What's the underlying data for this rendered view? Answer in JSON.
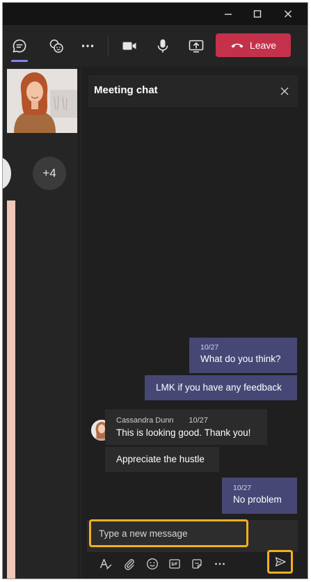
{
  "window": {
    "controls": [
      {
        "name": "minimize-button",
        "icon": "minimize-icon"
      },
      {
        "name": "maximize-button",
        "icon": "maximize-icon"
      },
      {
        "name": "close-window-button",
        "icon": "close-icon"
      }
    ]
  },
  "toolbar": {
    "icons": [
      "chat-icon",
      "reactions-icon",
      "more-options-icon",
      "camera-icon",
      "microphone-icon",
      "share-screen-icon"
    ],
    "leave_label": "Leave",
    "leave_color": "#c4314b",
    "active_color": "#7f85f5"
  },
  "stage": {
    "more_participants": "+4"
  },
  "chat": {
    "title": "Meeting chat",
    "messages": [
      {
        "sender": "me",
        "time": "10/27",
        "text": "What do you think?"
      },
      {
        "sender": "me",
        "time": "",
        "text": "LMK if you have any feedback"
      },
      {
        "sender": "Cassandra Dunn",
        "time": "10/27",
        "text": "This is looking good. Thank you!"
      },
      {
        "sender": "Cassandra Dunn",
        "time": "",
        "text": "Appreciate the hustle"
      },
      {
        "sender": "me",
        "time": "10/27",
        "text": "No problem"
      }
    ],
    "compose": {
      "placeholder": "Type a new message",
      "tools": [
        "format-icon",
        "attach-icon",
        "emoji-icon",
        "gif-icon",
        "sticker-icon",
        "more-icon"
      ],
      "send_icon": "send-icon",
      "highlight_color": "#f2b01e"
    },
    "bubble_color_me": "#464775",
    "bubble_color_other": "#2b2b2b"
  }
}
